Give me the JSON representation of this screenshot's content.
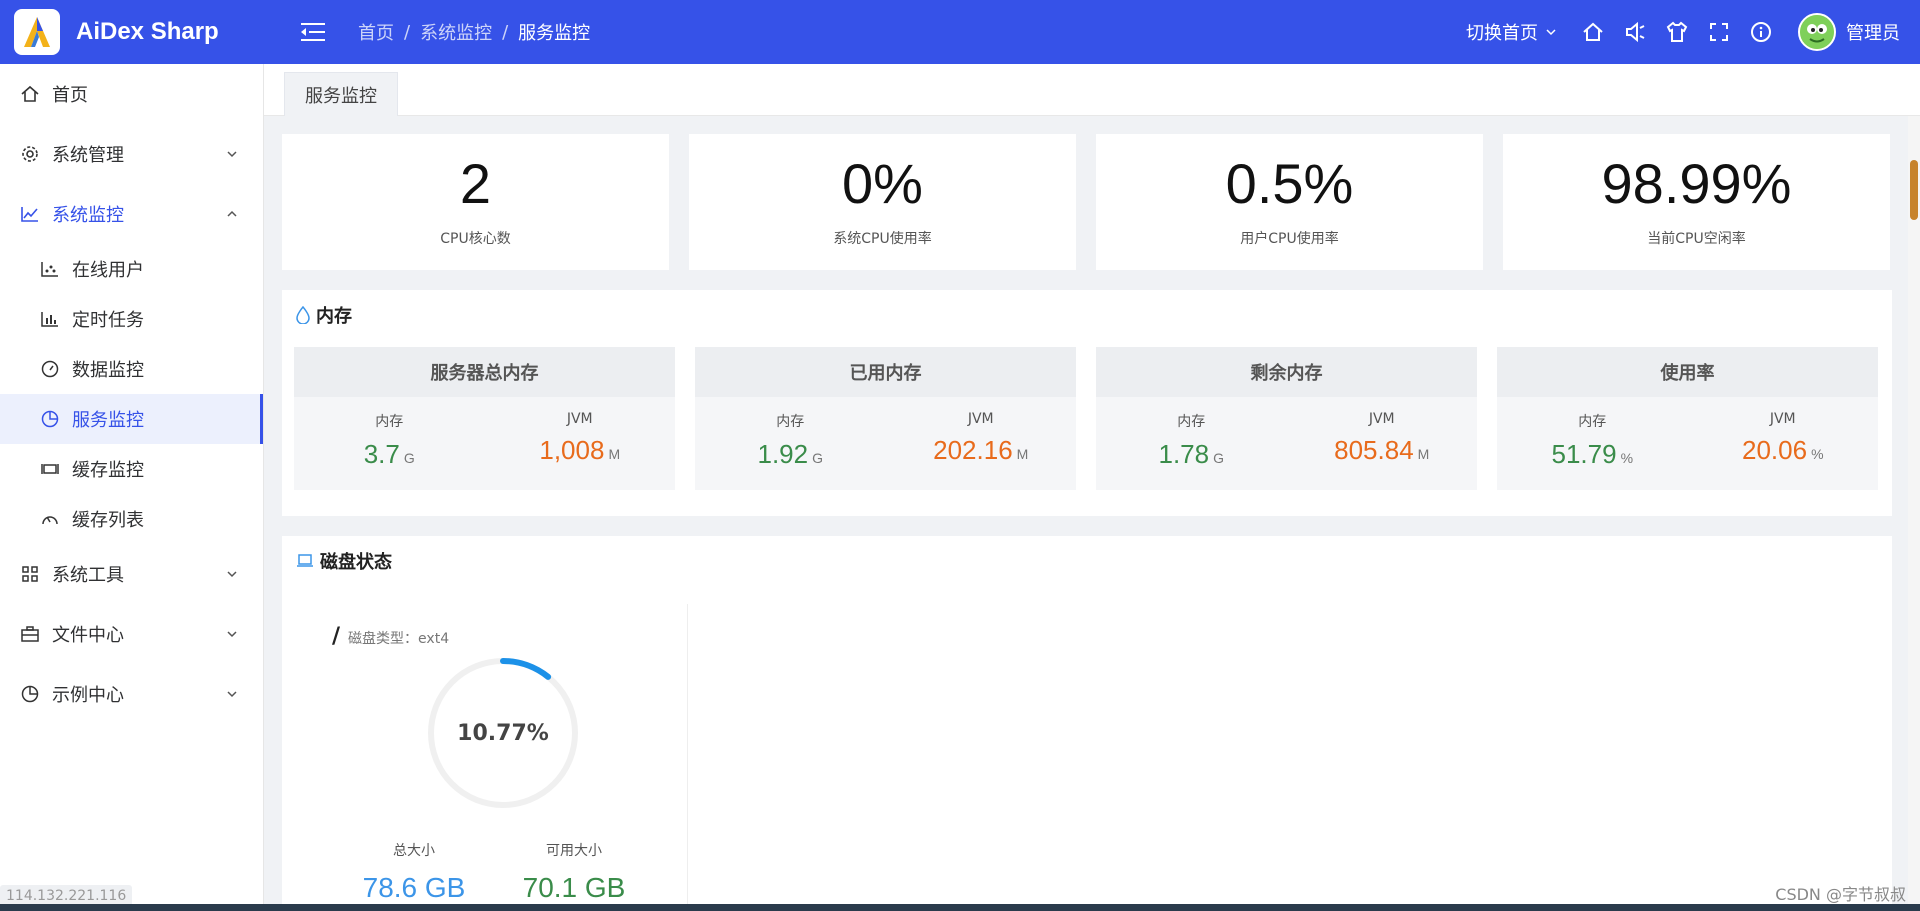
{
  "app": {
    "title": "AiDex Sharp"
  },
  "breadcrumb": [
    "首页",
    "系统监控",
    "服务监控"
  ],
  "header": {
    "switch_home": "切换首页",
    "user_name": "管理员"
  },
  "sidebar": {
    "items": [
      {
        "label": "首页",
        "icon": "home-icon"
      },
      {
        "label": "系统管理",
        "icon": "gear-icon"
      },
      {
        "label": "系统监控",
        "icon": "line-chart-icon"
      },
      {
        "label": "系统工具",
        "icon": "grid-icon"
      },
      {
        "label": "文件中心",
        "icon": "briefcase-icon"
      },
      {
        "label": "示例中心",
        "icon": "pie-icon"
      }
    ],
    "subitems": [
      {
        "label": "在线用户",
        "icon": "scatter-icon"
      },
      {
        "label": "定时任务",
        "icon": "bar-chart-icon"
      },
      {
        "label": "数据监控",
        "icon": "gauge-icon"
      },
      {
        "label": "服务监控",
        "icon": "pie-chart-icon",
        "active": true
      },
      {
        "label": "缓存监控",
        "icon": "cache-icon"
      },
      {
        "label": "缓存列表",
        "icon": "speedometer-icon"
      }
    ],
    "ip": "114.132.221.116"
  },
  "tab": {
    "label": "服务监控"
  },
  "cpu": [
    {
      "value": "2",
      "label": "CPU核心数"
    },
    {
      "value": "0%",
      "label": "系统CPU使用率"
    },
    {
      "value": "0.5%",
      "label": "用户CPU使用率"
    },
    {
      "value": "98.99%",
      "label": "当前CPU空闲率"
    }
  ],
  "memory": {
    "title": "内存",
    "col_mem": "内存",
    "col_jvm": "JVM",
    "boxes": [
      {
        "title": "服务器总内存",
        "mem": "3.7",
        "mem_unit": "G",
        "jvm": "1,008",
        "jvm_unit": "M"
      },
      {
        "title": "已用内存",
        "mem": "1.92",
        "mem_unit": "G",
        "jvm": "202.16",
        "jvm_unit": "M"
      },
      {
        "title": "剩余内存",
        "mem": "1.78",
        "mem_unit": "G",
        "jvm": "805.84",
        "jvm_unit": "M"
      },
      {
        "title": "使用率",
        "mem": "51.79",
        "mem_unit": "%",
        "jvm": "20.06",
        "jvm_unit": "%"
      }
    ]
  },
  "disk": {
    "title": "磁盘状态",
    "path": "/",
    "type_label": "磁盘类型：ext4",
    "usage_text": "10.77%",
    "usage": 10.77,
    "total_label": "总大小",
    "total": "78.6 GB",
    "free_label": "可用大小",
    "free": "70.1 GB"
  },
  "watermark": "CSDN @字节叔叔",
  "colors": {
    "primary": "#3652e8",
    "green": "#3a8c4a",
    "orange": "#e86b1c",
    "blue": "#3c95e8"
  }
}
